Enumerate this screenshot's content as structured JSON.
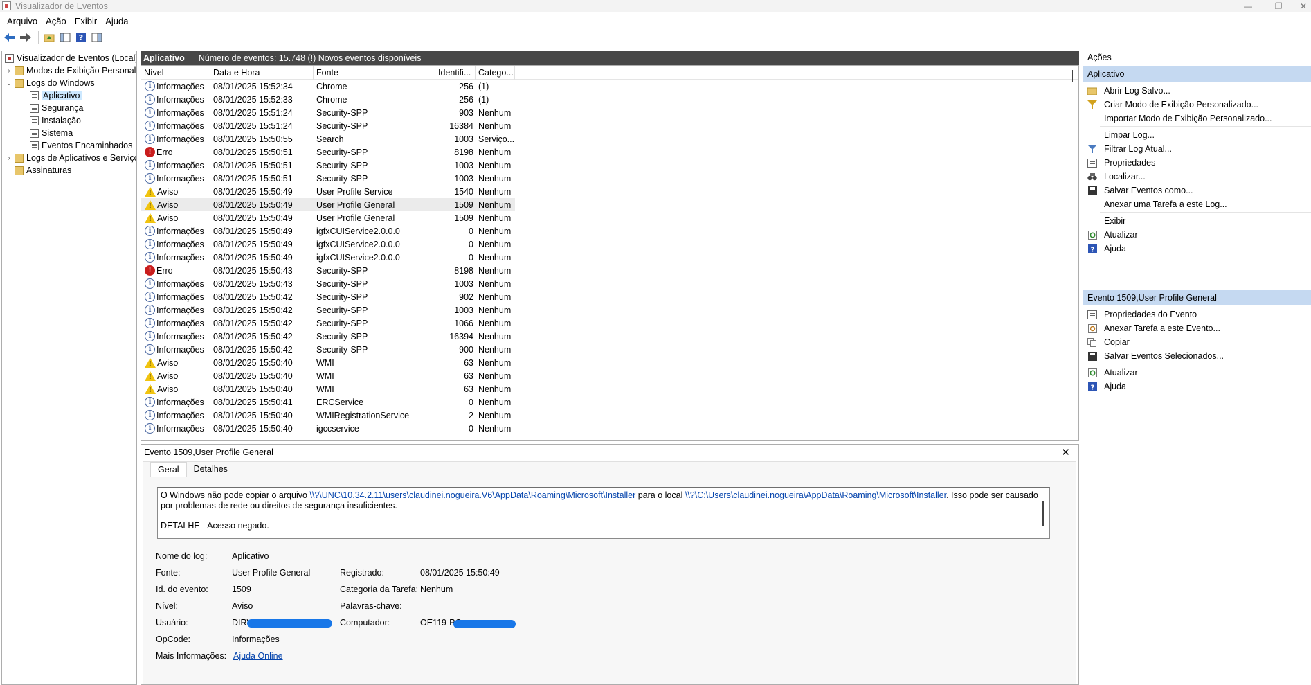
{
  "window": {
    "title": "Visualizador de Eventos",
    "minimize": "—",
    "maximize": "❐",
    "close": "✕"
  },
  "menu": [
    "Arquivo",
    "Ação",
    "Exibir",
    "Ajuda"
  ],
  "toolbar": {
    "icons": [
      "back-arrow-icon",
      "forward-arrow-icon",
      "folder-up-icon",
      "console-tree-icon",
      "help-icon",
      "action-pane-icon"
    ]
  },
  "tree": {
    "root": "Visualizador de Eventos (Local)",
    "custom_views": "Modos de Exibição Personalizados",
    "windows_logs": "Logs do Windows",
    "app": "Aplicativo",
    "security": "Segurança",
    "setup": "Instalação",
    "system": "Sistema",
    "forwarded": "Eventos Encaminhados",
    "apps_services": "Logs de Aplicativos e Serviços",
    "subscriptions": "Assinaturas"
  },
  "center": {
    "title": "Aplicativo",
    "info": "Número de eventos: 15.748 (!) Novos eventos disponíveis"
  },
  "columns": {
    "level": "Nível",
    "date": "Data e Hora",
    "source": "Fonte",
    "id": "Identifi...",
    "category": "Catego..."
  },
  "events": [
    {
      "level": "Informações",
      "type": "info",
      "date": "08/01/2025 15:52:34",
      "source": "Chrome",
      "id": "256",
      "category": "(1)"
    },
    {
      "level": "Informações",
      "type": "info",
      "date": "08/01/2025 15:52:33",
      "source": "Chrome",
      "id": "256",
      "category": "(1)"
    },
    {
      "level": "Informações",
      "type": "info",
      "date": "08/01/2025 15:51:24",
      "source": "Security-SPP",
      "id": "903",
      "category": "Nenhum"
    },
    {
      "level": "Informações",
      "type": "info",
      "date": "08/01/2025 15:51:24",
      "source": "Security-SPP",
      "id": "16384",
      "category": "Nenhum"
    },
    {
      "level": "Informações",
      "type": "info",
      "date": "08/01/2025 15:50:55",
      "source": "Search",
      "id": "1003",
      "category": "Serviço..."
    },
    {
      "level": "Erro",
      "type": "error",
      "date": "08/01/2025 15:50:51",
      "source": "Security-SPP",
      "id": "8198",
      "category": "Nenhum"
    },
    {
      "level": "Informações",
      "type": "info",
      "date": "08/01/2025 15:50:51",
      "source": "Security-SPP",
      "id": "1003",
      "category": "Nenhum"
    },
    {
      "level": "Informações",
      "type": "info",
      "date": "08/01/2025 15:50:51",
      "source": "Security-SPP",
      "id": "1003",
      "category": "Nenhum"
    },
    {
      "level": "Aviso",
      "type": "warn",
      "date": "08/01/2025 15:50:49",
      "source": "User Profile Service",
      "id": "1540",
      "category": "Nenhum"
    },
    {
      "level": "Aviso",
      "type": "warn",
      "date": "08/01/2025 15:50:49",
      "source": "User Profile General",
      "id": "1509",
      "category": "Nenhum",
      "selected": true
    },
    {
      "level": "Aviso",
      "type": "warn",
      "date": "08/01/2025 15:50:49",
      "source": "User Profile General",
      "id": "1509",
      "category": "Nenhum"
    },
    {
      "level": "Informações",
      "type": "info",
      "date": "08/01/2025 15:50:49",
      "source": "igfxCUIService2.0.0.0",
      "id": "0",
      "category": "Nenhum"
    },
    {
      "level": "Informações",
      "type": "info",
      "date": "08/01/2025 15:50:49",
      "source": "igfxCUIService2.0.0.0",
      "id": "0",
      "category": "Nenhum"
    },
    {
      "level": "Informações",
      "type": "info",
      "date": "08/01/2025 15:50:49",
      "source": "igfxCUIService2.0.0.0",
      "id": "0",
      "category": "Nenhum"
    },
    {
      "level": "Erro",
      "type": "error",
      "date": "08/01/2025 15:50:43",
      "source": "Security-SPP",
      "id": "8198",
      "category": "Nenhum"
    },
    {
      "level": "Informações",
      "type": "info",
      "date": "08/01/2025 15:50:43",
      "source": "Security-SPP",
      "id": "1003",
      "category": "Nenhum"
    },
    {
      "level": "Informações",
      "type": "info",
      "date": "08/01/2025 15:50:42",
      "source": "Security-SPP",
      "id": "902",
      "category": "Nenhum"
    },
    {
      "level": "Informações",
      "type": "info",
      "date": "08/01/2025 15:50:42",
      "source": "Security-SPP",
      "id": "1003",
      "category": "Nenhum"
    },
    {
      "level": "Informações",
      "type": "info",
      "date": "08/01/2025 15:50:42",
      "source": "Security-SPP",
      "id": "1066",
      "category": "Nenhum"
    },
    {
      "level": "Informações",
      "type": "info",
      "date": "08/01/2025 15:50:42",
      "source": "Security-SPP",
      "id": "16394",
      "category": "Nenhum"
    },
    {
      "level": "Informações",
      "type": "info",
      "date": "08/01/2025 15:50:42",
      "source": "Security-SPP",
      "id": "900",
      "category": "Nenhum"
    },
    {
      "level": "Aviso",
      "type": "warn",
      "date": "08/01/2025 15:50:40",
      "source": "WMI",
      "id": "63",
      "category": "Nenhum"
    },
    {
      "level": "Aviso",
      "type": "warn",
      "date": "08/01/2025 15:50:40",
      "source": "WMI",
      "id": "63",
      "category": "Nenhum"
    },
    {
      "level": "Aviso",
      "type": "warn",
      "date": "08/01/2025 15:50:40",
      "source": "WMI",
      "id": "63",
      "category": "Nenhum"
    },
    {
      "level": "Informações",
      "type": "info",
      "date": "08/01/2025 15:50:41",
      "source": "ERCService",
      "id": "0",
      "category": "Nenhum"
    },
    {
      "level": "Informações",
      "type": "info",
      "date": "08/01/2025 15:50:40",
      "source": "WMIRegistrationService",
      "id": "2",
      "category": "Nenhum"
    },
    {
      "level": "Informações",
      "type": "info",
      "date": "08/01/2025 15:50:40",
      "source": "igccservice",
      "id": "0",
      "category": "Nenhum"
    }
  ],
  "detail": {
    "title": "Evento 1509,User Profile General",
    "close": "✕",
    "tab_general": "Geral",
    "tab_details": "Detalhes",
    "msg_pre": "O Windows não pode copiar o arquivo ",
    "msg_link1": "\\\\?\\UNC\\10.34.2.11\\users\\claudinei.nogueira.V6\\AppData\\Roaming\\Microsoft\\Installer",
    "msg_mid": " para o local ",
    "msg_link2": "\\\\?\\C:\\Users\\claudinei.nogueira\\AppData\\Roaming\\Microsoft\\Installer",
    "msg_post": ". Isso pode ser causado por problemas de rede ou direitos de segurança insuficientes.",
    "msg_detail": "DETALHE - Acesso negado.",
    "labels": {
      "log_name": "Nome do log:",
      "source": "Fonte:",
      "event_id": "Id. do evento:",
      "level": "Nível:",
      "user": "Usuário:",
      "opcode": "OpCode:",
      "more_info": "Mais Informações:",
      "logged": "Registrado:",
      "task_category": "Categoria da Tarefa:",
      "keywords": "Palavras-chave:",
      "computer": "Computador:"
    },
    "values": {
      "log_name": "Aplicativo",
      "source": "User Profile General",
      "event_id": "1509",
      "level": "Aviso",
      "user": "DIR\\",
      "opcode": "Informações",
      "more_info": "Ajuda Online",
      "logged": "08/01/2025 15:50:49",
      "task_category": "Nenhum",
      "keywords": "",
      "computer": "OE119-PC"
    }
  },
  "actions": {
    "header": "Ações",
    "section1": "Aplicativo",
    "items1": [
      {
        "label": "Abrir Log Salvo...",
        "icon": "open-folder-icon"
      },
      {
        "label": "Criar Modo de Exibição Personalizado...",
        "icon": "create-filter-icon"
      },
      {
        "label": "Importar Modo de Exibição Personalizado...",
        "icon": ""
      },
      {
        "label": "Limpar Log...",
        "icon": ""
      },
      {
        "label": "Filtrar Log Atual...",
        "icon": "filter-icon"
      },
      {
        "label": "Propriedades",
        "icon": "properties-icon"
      },
      {
        "label": "Localizar...",
        "icon": "binoculars-icon"
      },
      {
        "label": "Salvar Eventos como...",
        "icon": "save-icon"
      },
      {
        "label": "Anexar uma Tarefa a este Log...",
        "icon": ""
      },
      {
        "label": "Exibir",
        "icon": ""
      },
      {
        "label": "Atualizar",
        "icon": "refresh-icon"
      },
      {
        "label": "Ajuda",
        "icon": "help-icon"
      }
    ],
    "section2": "Evento 1509,User Profile General",
    "items2": [
      {
        "label": "Propriedades do Evento",
        "icon": "properties-icon"
      },
      {
        "label": "Anexar Tarefa a este Evento...",
        "icon": "task-icon"
      },
      {
        "label": "Copiar",
        "icon": "copy-icon"
      },
      {
        "label": "Salvar Eventos Selecionados...",
        "icon": "save-icon"
      },
      {
        "label": "Atualizar",
        "icon": "refresh-icon"
      },
      {
        "label": "Ajuda",
        "icon": "help-icon"
      }
    ]
  },
  "colors": {
    "accent_section": "#c5d9f1",
    "header_bar": "#474747",
    "selection": "#cce8ff",
    "link": "#0645ad",
    "error": "#c91d1d",
    "warning": "#f1c40f",
    "info": "#3b5b9a",
    "redaction": "#1877e8"
  }
}
